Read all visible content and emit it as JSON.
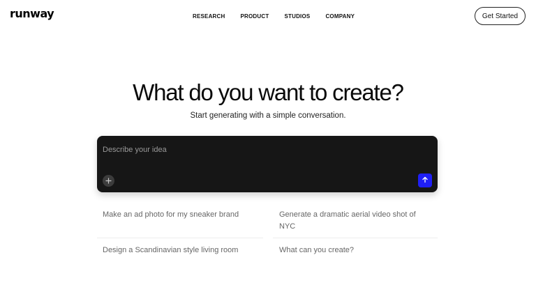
{
  "header": {
    "logo": "runway",
    "nav": [
      "RESEARCH",
      "PRODUCT",
      "STUDIOS",
      "COMPANY"
    ],
    "cta_label": "Get Started"
  },
  "hero": {
    "title": "What do you want to create?",
    "subtitle": "Start generating with a simple conversation."
  },
  "prompt": {
    "placeholder": "Describe your idea",
    "add_icon": "plus-icon",
    "send_icon": "arrow-up-icon",
    "send_color": "#1f1ff5"
  },
  "suggestions": [
    "Make an ad photo for my sneaker brand",
    "Generate a dramatic aerial video shot of NYC",
    "Design a Scandinavian style living room",
    "What can you create?"
  ]
}
